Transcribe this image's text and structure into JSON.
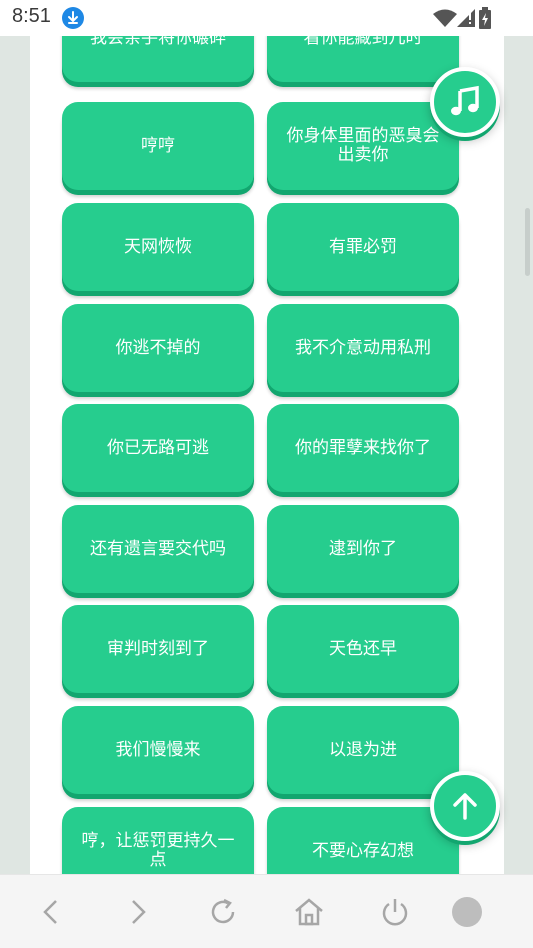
{
  "status_bar": {
    "time": "8:51",
    "icons": [
      "download-icon",
      "wifi-icon",
      "signal-icon",
      "battery-icon"
    ]
  },
  "phrases": [
    "我会亲手将你碾碎",
    "看你能藏到几时",
    "哼哼",
    "你身体里面的恶臭会出卖你",
    "天网恢恢",
    "有罪必罚",
    "你逃不掉的",
    "我不介意动用私刑",
    "你已无路可逃",
    "你的罪孽来找你了",
    "还有遗言要交代吗",
    "逮到你了",
    "审判时刻到了",
    "天色还早",
    "我们慢慢来",
    "以退为进",
    "哼，让惩罚更持久一点",
    "不要心存幻想"
  ],
  "fabs": {
    "music_icon": "music-note-icon",
    "scroll_top_icon": "arrow-up-icon"
  },
  "nav": [
    "back-icon",
    "forward-icon",
    "reload-icon",
    "home-icon",
    "power-icon",
    "record-icon"
  ],
  "colors": {
    "button": "#26cd8e",
    "button_shadow": "#12a66f",
    "background": "#dfe6e2",
    "panel": "#ffffff"
  }
}
